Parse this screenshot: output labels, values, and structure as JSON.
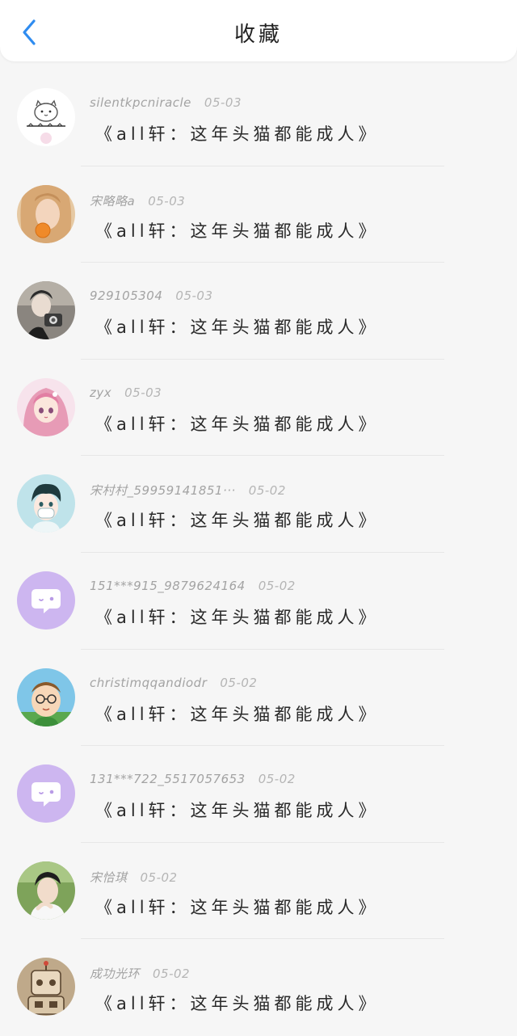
{
  "header": {
    "title": "收藏",
    "back_icon": "chevron-left-icon",
    "accent_color": "#2f8cf0"
  },
  "favorites": [
    {
      "user": "silentkpcniracle",
      "date": "05-03",
      "title": "《all轩：这年头猫都能成人》",
      "avatar": "cat-cartoon"
    },
    {
      "user": "宋略略a",
      "date": "05-03",
      "title": "《all轩：这年头猫都能成人》",
      "avatar": "photo-person-orange"
    },
    {
      "user": "929105304",
      "date": "05-03",
      "title": "《all轩：这年头猫都能成人》",
      "avatar": "photo-person-dark"
    },
    {
      "user": "zyx",
      "date": "05-03",
      "title": "《all轩：这年头猫都能成人》",
      "avatar": "anime-pink-hair"
    },
    {
      "user": "宋村村_59959141851···",
      "date": "05-02",
      "title": "《all轩：这年头猫都能成人》",
      "avatar": "anime-boy-mask"
    },
    {
      "user": "151***915_9879624164",
      "date": "05-02",
      "title": "《all轩：这年头猫都能成人》",
      "avatar": "default-chat-bubble"
    },
    {
      "user": "christimqqandiodr",
      "date": "05-02",
      "title": "《all轩：这年头猫都能成人》",
      "avatar": "cartoon-glasses"
    },
    {
      "user": "131***722_5517057653",
      "date": "05-02",
      "title": "《all轩：这年头猫都能成人》",
      "avatar": "default-chat-bubble"
    },
    {
      "user": "宋恰琪",
      "date": "05-02",
      "title": "《all轩：这年头猫都能成人》",
      "avatar": "photo-person-green"
    },
    {
      "user": "成功光环",
      "date": "05-02",
      "title": "《all轩：这年头猫都能成人》",
      "avatar": "cartoon-robot"
    }
  ]
}
